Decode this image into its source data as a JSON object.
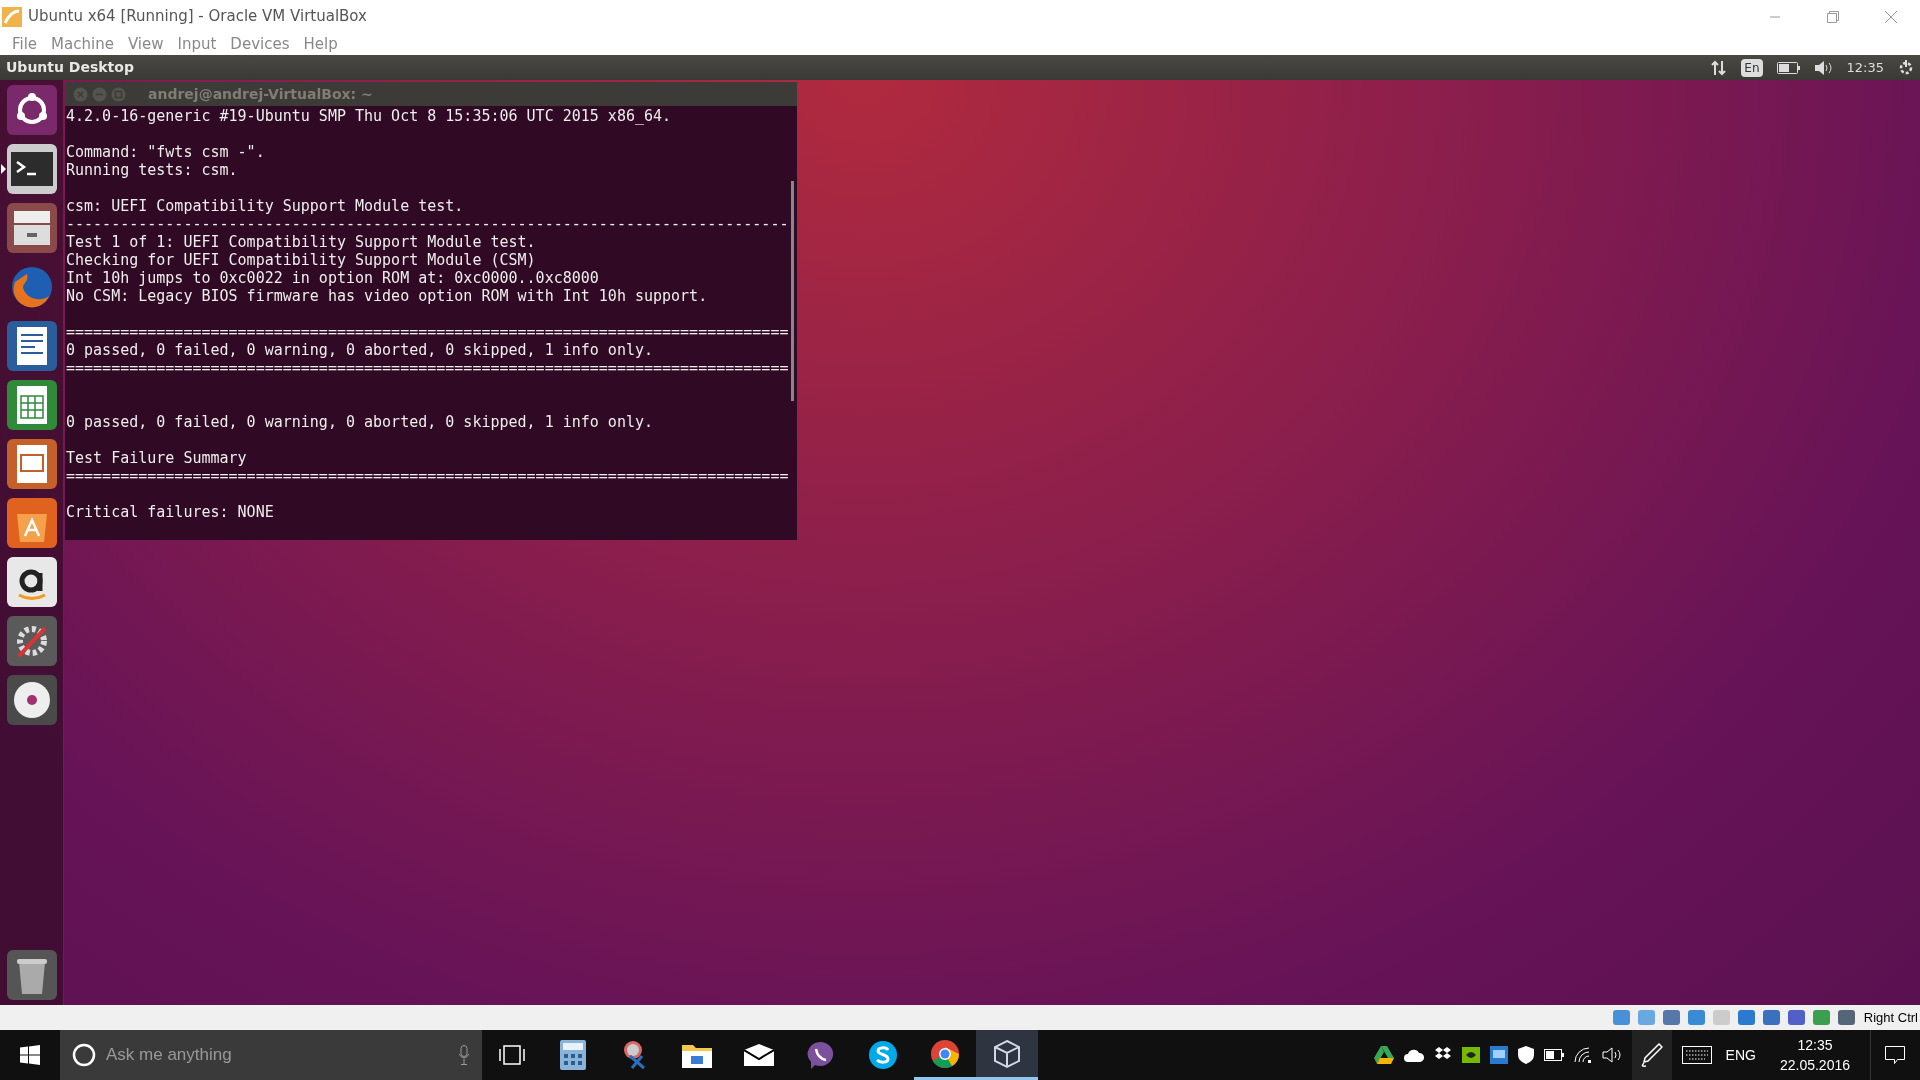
{
  "window": {
    "title": "Ubuntu x64 [Running] - Oracle VM VirtualBox"
  },
  "menu": [
    "File",
    "Machine",
    "View",
    "Input",
    "Devices",
    "Help"
  ],
  "top_panel": {
    "title": "Ubuntu Desktop",
    "keyboard": "En",
    "time": "12:35"
  },
  "launcher": [
    {
      "kind": "dash",
      "running": false
    },
    {
      "kind": "terminal",
      "running": true
    },
    {
      "kind": "files",
      "running": false
    },
    {
      "kind": "browser",
      "running": false
    },
    {
      "kind": "writer",
      "running": false
    },
    {
      "kind": "calc",
      "running": false
    },
    {
      "kind": "impress",
      "running": false
    },
    {
      "kind": "store",
      "running": false
    },
    {
      "kind": "amazon",
      "running": false
    },
    {
      "kind": "settings",
      "running": false
    },
    {
      "kind": "disc",
      "running": false
    },
    {
      "kind": "trash",
      "running": false
    }
  ],
  "terminal": {
    "title": "andrej@andrej-VirtualBox: ~",
    "blocks": [
      {
        "lines": [
          "4.2.0-16-generic #19-Ubuntu SMP Thu Oct 8 15:35:06 UTC 2015 x86_64."
        ]
      },
      {
        "lines": [
          "Command: \"fwts csm -\".",
          "Running tests: csm."
        ]
      },
      {
        "lines": [
          "csm: UEFI Compatibility Support Module test.",
          "--------------------------------------------------------------------------------",
          "Test 1 of 1: UEFI Compatibility Support Module test.",
          "Checking for UEFI Compatibility Support Module (CSM)",
          "Int 10h jumps to 0xc0022 in option ROM at: 0xc0000..0xc8000",
          "No CSM: Legacy BIOS firmware has video option ROM with Int 10h support."
        ]
      },
      {
        "lines": [
          "================================================================================",
          "0 passed, 0 failed, 0 warning, 0 aborted, 0 skipped, 1 info only.",
          "================================================================================"
        ]
      },
      {
        "lines": [
          "0 passed, 0 failed, 0 warning, 0 aborted, 0 skipped, 1 info only."
        ]
      },
      {
        "lines": [
          "Test Failure Summary",
          "================================================================================"
        ]
      },
      {
        "lines": [
          "Critical failures: NONE"
        ]
      }
    ]
  },
  "vbox_status": {
    "host_key": "Right Ctrl"
  },
  "taskbar": {
    "search_placeholder": "Ask me anything",
    "apps": [
      {
        "kind": "calculator",
        "running": false,
        "active": false
      },
      {
        "kind": "snipping",
        "running": false,
        "active": false
      },
      {
        "kind": "explorer",
        "running": false,
        "active": false
      },
      {
        "kind": "mail",
        "running": false,
        "active": false
      },
      {
        "kind": "viber",
        "running": false,
        "active": false
      },
      {
        "kind": "skype",
        "running": false,
        "active": false
      },
      {
        "kind": "chrome",
        "running": true,
        "active": false
      },
      {
        "kind": "virtualbox",
        "running": true,
        "active": true
      }
    ],
    "language": "ENG",
    "time": "12:35",
    "date": "22.05.2016"
  }
}
